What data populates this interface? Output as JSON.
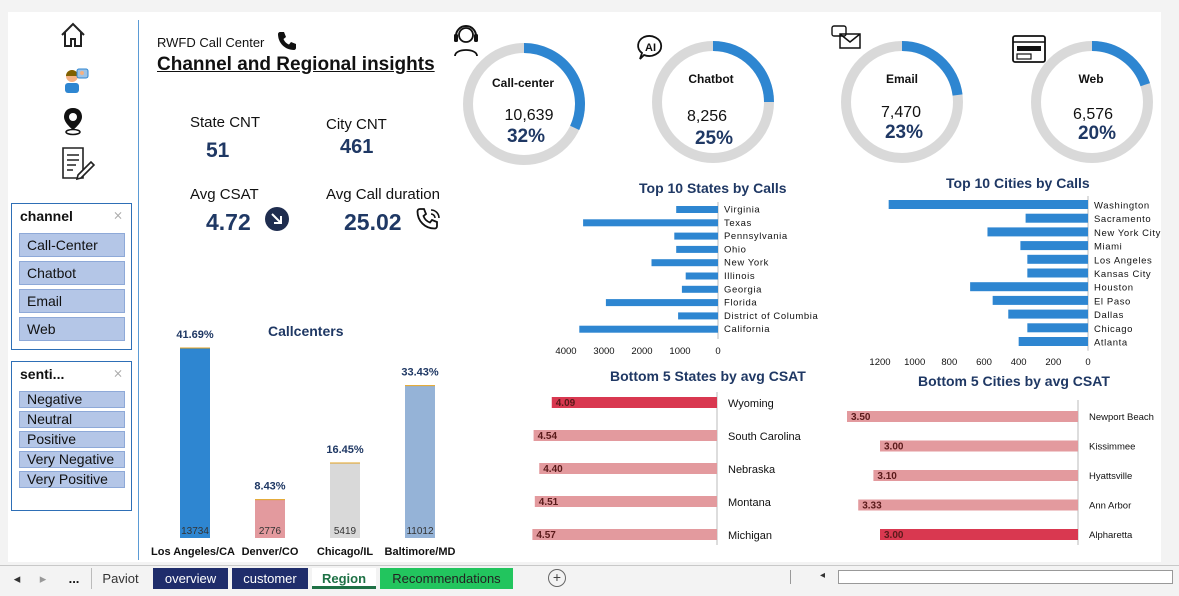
{
  "header": {
    "subtitle": "RWFD Call Center",
    "title": "Channel and Regional insights"
  },
  "kpis": {
    "state_cnt_label": "State CNT",
    "state_cnt_value": "51",
    "city_cnt_label": "City CNT",
    "city_cnt_value": "461",
    "avg_csat_label": "Avg CSAT",
    "avg_csat_value": "4.72",
    "avg_call_label": "Avg Call duration",
    "avg_call_value": "25.02"
  },
  "channel_slicer": {
    "title": "channel",
    "items": [
      "Call-Center",
      "Chatbot",
      "Email",
      "Web"
    ]
  },
  "sentiment_slicer": {
    "title": "senti...",
    "items": [
      "Negative",
      "Neutral",
      "Positive",
      "Very Negative",
      "Very Positive"
    ]
  },
  "donuts": [
    {
      "name": "Call-center",
      "count": "10,639",
      "pct": "32%",
      "fraction": 0.32,
      "icon": "headset-icon"
    },
    {
      "name": "Chatbot",
      "count": "8,256",
      "pct": "25%",
      "fraction": 0.25,
      "icon": "ai-chat-icon"
    },
    {
      "name": "Email",
      "count": "7,470",
      "pct": "23%",
      "fraction": 0.23,
      "icon": "email-icon"
    },
    {
      "name": "Web",
      "count": "6,576",
      "pct": "20%",
      "fraction": 0.2,
      "icon": "web-icon"
    }
  ],
  "colors": {
    "accent_blue": "#2e86d1",
    "navy": "#1f3864",
    "donut_track": "#d9d9d9",
    "bar_pink": "#e39a9e",
    "bar_red": "#d93850",
    "bar_grey": "#d9d9d9",
    "bar_light_blue": "#95b3d7"
  },
  "chart_data": [
    {
      "type": "bar",
      "title": "Callcenters",
      "categories": [
        "Los Angeles/CA",
        "Denver/CO",
        "Chicago/IL",
        "Baltimore/MD"
      ],
      "values": [
        13734,
        2776,
        5419,
        11012
      ],
      "pct_labels": [
        "41.69%",
        "8.43%",
        "16.45%",
        "33.43%"
      ],
      "colors": [
        "#2e86d1",
        "#e39a9e",
        "#d9d9d9",
        "#95b3d7"
      ]
    },
    {
      "type": "bar",
      "orientation": "horizontal-reversed",
      "title": "Top 10  States by Calls",
      "categories": [
        "Virginia",
        "Texas",
        "Pennsylvania",
        "Ohio",
        "New York",
        "Illinois",
        "Georgia",
        "Florida",
        "District of Columbia",
        "California"
      ],
      "values": [
        1100,
        3550,
        1150,
        1100,
        1750,
        850,
        950,
        2950,
        1050,
        3650
      ],
      "xticks": [
        "4000",
        "3000",
        "2000",
        "1000",
        "0"
      ],
      "xlim": [
        0,
        4000
      ]
    },
    {
      "type": "bar",
      "orientation": "horizontal-reversed",
      "title": "Top 10 Cities by Calls",
      "categories": [
        "Washington",
        "Sacramento",
        "New York City",
        "Miami",
        "Los Angeles",
        "Kansas City",
        "Houston",
        "El Paso",
        "Dallas",
        "Chicago",
        "Atlanta"
      ],
      "values": [
        1150,
        360,
        580,
        390,
        350,
        350,
        680,
        550,
        460,
        350,
        400
      ],
      "xticks": [
        "1200",
        "1000",
        "800",
        "600",
        "400",
        "200",
        "0"
      ],
      "xlim": [
        0,
        1200
      ]
    },
    {
      "type": "bar",
      "orientation": "horizontal-reversed",
      "title": "Bottom 5 States by avg CSAT",
      "categories": [
        "Wyoming",
        "South Carolina",
        "Nebraska",
        "Montana",
        "Michigan"
      ],
      "values": [
        4.09,
        4.54,
        4.4,
        4.51,
        4.57
      ],
      "value_labels": [
        "4.09",
        "4.54",
        "4.40",
        "4.51",
        "4.57"
      ],
      "highlight": "Wyoming"
    },
    {
      "type": "bar",
      "orientation": "horizontal-reversed",
      "title": "Bottom 5 Cities by  avg CSAT",
      "categories": [
        "Newport Beach",
        "Kissimmee",
        "Hyattsville",
        "Ann Arbor",
        "Alpharetta"
      ],
      "values": [
        3.5,
        3.0,
        3.1,
        3.33,
        3.0
      ],
      "value_labels": [
        "3.50",
        "3.00",
        "3.10",
        "3.33",
        "3.00"
      ],
      "highlight": "Alpharetta"
    }
  ],
  "tabs": {
    "nav_first": "◂",
    "nav_next": "▸",
    "more": "...",
    "items": [
      "Paviot",
      "overview",
      "customer",
      "Region",
      "Recommendations"
    ],
    "add": "+"
  }
}
